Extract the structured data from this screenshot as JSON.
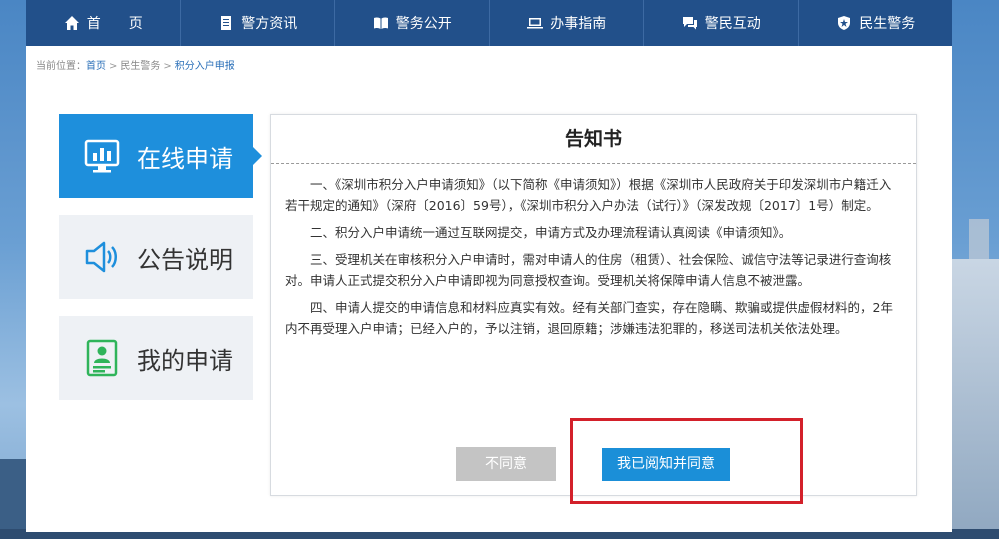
{
  "nav": [
    {
      "label": "首　　页",
      "icon": "home-icon"
    },
    {
      "label": "警方资讯",
      "icon": "document-icon"
    },
    {
      "label": "警务公开",
      "icon": "open-book-icon"
    },
    {
      "label": "办事指南",
      "icon": "laptop-icon"
    },
    {
      "label": "警民互动",
      "icon": "chat-icon"
    },
    {
      "label": "民生警务",
      "icon": "police-badge-icon"
    }
  ],
  "breadcrumb": {
    "prefix": "当前位置：",
    "items": [
      "首页",
      "民生警务",
      "积分入户申报"
    ],
    "separator": ">"
  },
  "sidebar": [
    {
      "label": "在线申请",
      "icon": "chart-monitor-icon",
      "active": true
    },
    {
      "label": "公告说明",
      "icon": "speaker-icon",
      "active": false
    },
    {
      "label": "我的申请",
      "icon": "user-document-icon",
      "active": false
    }
  ],
  "notice": {
    "title": "告知书",
    "paragraphs": [
      "一、《深圳市积分入户申请须知》（以下简称《申请须知》）根据《深圳市人民政府关于印发深圳市户籍迁入若干规定的通知》（深府〔2016〕59号），《深圳市积分入户办法（试行）》（深发改规〔2017〕1号）制定。",
      "二、积分入户申请统一通过互联网提交，申请方式及办理流程请认真阅读《申请须知》。",
      "三、受理机关在审核积分入户申请时，需对申请人的住房（租赁）、社会保险、诚信守法等记录进行查询核对。申请人正式提交积分入户申请即视为同意授权查询。受理机关将保障申请人信息不被泄露。",
      "四、申请人提交的申请信息和材料应真实有效。经有关部门查实，存在隐瞒、欺骗或提供虚假材料的，2年内不再受理入户申请；已经入户的，予以注销，退回原籍；涉嫌违法犯罪的，移送司法机关依法处理。"
    ]
  },
  "buttons": {
    "disagree": "不同意",
    "agree": "我已阅知并同意"
  },
  "colors": {
    "nav_bg": "#22508a",
    "active_blue": "#1e8fdc",
    "highlight_red": "#d3202a",
    "disabled_gray": "#c4c4c4"
  }
}
